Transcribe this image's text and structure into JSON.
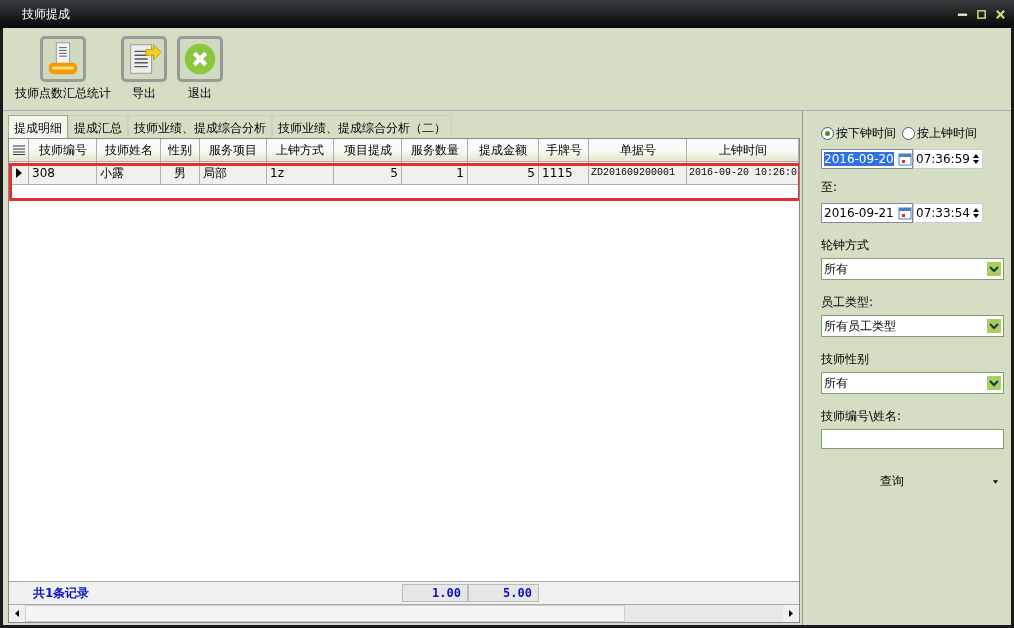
{
  "window": {
    "title": "技师提成"
  },
  "toolbar": [
    {
      "kind": "report",
      "label": "技师点数汇总统计"
    },
    {
      "kind": "export",
      "label": "导出"
    },
    {
      "kind": "exit",
      "label": "退出"
    }
  ],
  "tabs": [
    {
      "label": "提成明细",
      "selected": true
    },
    {
      "label": "提成汇总",
      "selected": false
    },
    {
      "label": "技师业绩、提成综合分析",
      "selected": false
    },
    {
      "label": "技师业绩、提成综合分析（二）",
      "selected": false
    }
  ],
  "table": {
    "columns": [
      {
        "label": "技师编号"
      },
      {
        "label": "技师姓名"
      },
      {
        "label": "性别"
      },
      {
        "label": "服务项目"
      },
      {
        "label": "上钟方式"
      },
      {
        "label": "项目提成"
      },
      {
        "label": "服务数量"
      },
      {
        "label": "提成金额"
      },
      {
        "label": "手牌号"
      },
      {
        "label": "单据号"
      },
      {
        "label": "上钟时间"
      }
    ],
    "rows": [
      {
        "selected": true,
        "cells": [
          "308",
          "小露",
          "男",
          "局部",
          "1z",
          "5",
          "1",
          "5",
          "1115",
          "ZD201609200001",
          "2016-09-20 10:26:0"
        ]
      }
    ],
    "footer": {
      "count": "共1条记录",
      "totals": [
        "1.00",
        "5.00"
      ]
    }
  },
  "filter": {
    "radios": [
      {
        "label": "按下钟时间",
        "selected": true
      },
      {
        "label": "按上钟时间",
        "selected": false
      }
    ],
    "from": {
      "date": "2016-09-20",
      "time": "07:36:59",
      "highlighted": true
    },
    "to_label": "至:",
    "to": {
      "date": "2016-09-21",
      "time": "07:33:54",
      "highlighted": false
    },
    "selects": [
      {
        "label": "轮钟方式",
        "value": "所有"
      },
      {
        "label": "员工类型:",
        "value": "所有员工类型"
      },
      {
        "label": "技师性别",
        "value": "所有"
      }
    ],
    "search": {
      "label": "技师编号\\姓名:"
    },
    "query_button": "查询"
  }
}
